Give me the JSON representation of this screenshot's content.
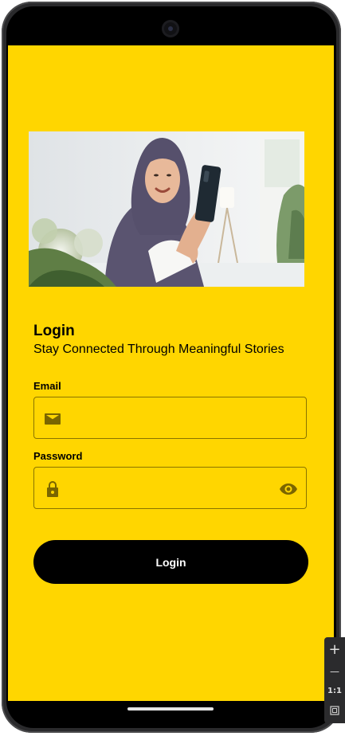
{
  "hero": {
    "icon": "woman-video-call-photo"
  },
  "login": {
    "title": "Login",
    "subtitle": "Stay Connected Through Meaningful Stories",
    "email_label": "Email",
    "email_value": "",
    "email_icon": "mail-icon",
    "password_label": "Password",
    "password_value": "",
    "password_icon": "lock-icon",
    "visibility_icon": "eye-icon",
    "button_label": "Login"
  },
  "emulator_toolbar": {
    "zoom_in": "+",
    "zoom_out": "—",
    "actual_size": "1:1",
    "fit_icon": "fit-screen-icon"
  },
  "colors": {
    "background": "#FFD600",
    "button": "#000000",
    "icon": "#7A6500"
  }
}
